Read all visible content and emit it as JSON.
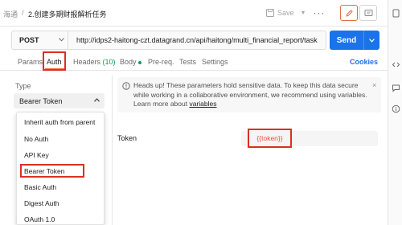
{
  "breadcrumb": {
    "root": "海通",
    "separator": "/",
    "title": "2.创建多期财报解析任务"
  },
  "toolbar": {
    "save_label": "Save",
    "more_label": "···"
  },
  "request": {
    "method": "POST",
    "url": "http://idps2-haitong-czt.datagrand.cn/api/haitong/multi_financial_report/task",
    "send_label": "Send"
  },
  "tabs": {
    "params": "Params",
    "auth": "Auth",
    "headers": "Headers",
    "headers_count": "(10)",
    "body": "Body",
    "prereq": "Pre-req.",
    "tests": "Tests",
    "settings": "Settings",
    "cookies": "Cookies"
  },
  "auth": {
    "type_label": "Type",
    "selected_type": "Bearer Token",
    "options": [
      "Inherit auth from parent",
      "No Auth",
      "API Key",
      "Bearer Token",
      "Basic Auth",
      "Digest Auth",
      "OAuth 1.0"
    ],
    "notice_text": "Heads up! These parameters hold sensitive data. To keep this data secure while working in a collaborative environment, we recommend using variables. Learn more about ",
    "notice_link": "variables",
    "notice_close": "×",
    "token_label": "Token",
    "token_value": "{{token}}"
  },
  "colors": {
    "accent_orange": "#ff6c37",
    "send_blue": "#1a73e8",
    "annotation_red": "#d93025",
    "variable_red": "#e5533b"
  }
}
